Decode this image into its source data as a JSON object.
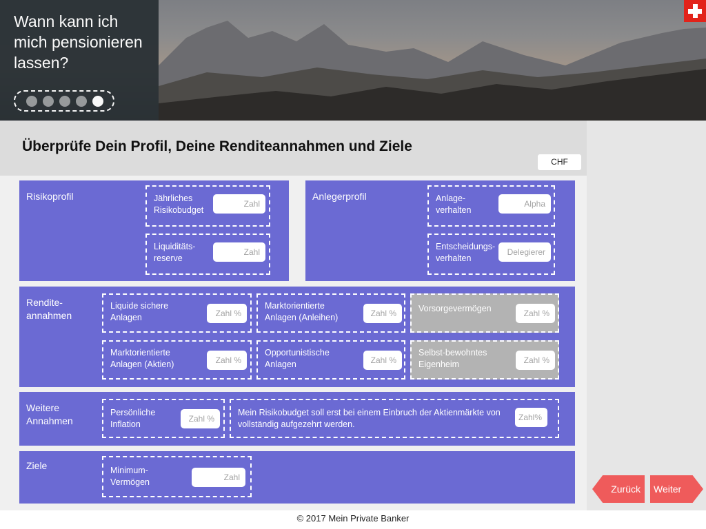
{
  "header": {
    "title": "Wann kann ich mich pensionieren lassen?",
    "progress": {
      "total_steps": 5,
      "current_step": 5
    },
    "flag_icon": "swiss-flag-icon"
  },
  "main": {
    "headline": "Überprüfe Dein Profil, Deine Renditeannahmen und Ziele",
    "currency": "CHF"
  },
  "sections": {
    "risikoprofil": {
      "label": "Risikoprofil",
      "fields": [
        {
          "label": "Jährliches Risikobudget",
          "placeholder": "Zahl"
        },
        {
          "label": "Liquiditäts-reserve",
          "placeholder": "Zahl"
        }
      ]
    },
    "anlegerprofil": {
      "label": "Anlegerprofil",
      "fields": [
        {
          "label": "Anlage-verhalten",
          "value": "Alpha"
        },
        {
          "label": "Entscheidungs-verhalten",
          "value": "Delegierer"
        }
      ]
    },
    "rendite": {
      "label": "Rendite-annahmen",
      "fields": [
        {
          "label": "Liquide sichere Anlagen",
          "placeholder": "Zahl %"
        },
        {
          "label": "Marktorientierte Anlagen (Anleihen)",
          "placeholder": "Zahl %"
        },
        {
          "label": "Vorsorgevermögen",
          "placeholder": "Zahl %"
        },
        {
          "label": "Marktorientierte Anlagen (Aktien)",
          "placeholder": "Zahl %"
        },
        {
          "label": "Opportunistische Anlagen",
          "placeholder": "Zahl %"
        },
        {
          "label": "Selbst-bewohntes Eigenheim",
          "placeholder": "Zahl %"
        }
      ]
    },
    "weitere": {
      "label": "Weitere Annahmen",
      "fields": [
        {
          "label": "Persönliche Inflation",
          "placeholder": "Zahl %"
        },
        {
          "label": "Mein Risikobudget soll erst bei einem Einbruch der Aktienmärkte von vollständig aufgezehrt werden.",
          "placeholder": "Zahl%"
        }
      ]
    },
    "ziele": {
      "label": "Ziele",
      "fields": [
        {
          "label": "Minimum-Vermögen",
          "placeholder": "Zahl"
        }
      ]
    }
  },
  "nav": {
    "back_label": "Zurück",
    "next_label": "Weiter"
  },
  "footer": {
    "copyright": "© 2017 Mein Private Banker"
  },
  "colors": {
    "section_bg": "#6b6ad3",
    "nav_button": "#ef5b5b",
    "flag_red": "#e2231a",
    "disabled_field": "#b3b3b3"
  }
}
